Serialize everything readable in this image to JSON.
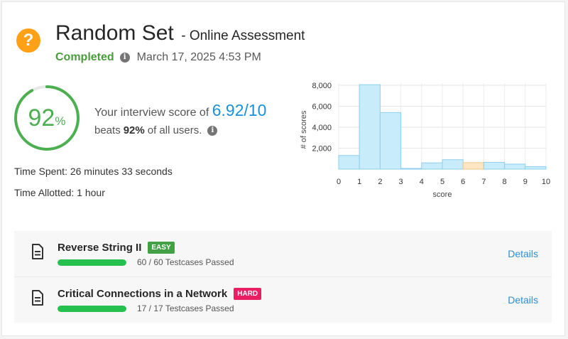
{
  "header": {
    "title": "Random Set",
    "subtitle": "- Online Assessment",
    "status": "Completed",
    "date": "March 17, 2025 4:53 PM",
    "icon": "question-icon"
  },
  "score": {
    "percent": "92",
    "percent_sign": "%",
    "percent_value": 92,
    "line1_prefix": "Your interview score of ",
    "value": "6.92/10",
    "line2_prefix": "beats",
    "line2_bold": "92%",
    "line2_suffix": "of all users."
  },
  "time": {
    "spent": "Time Spent: 26 minutes 33 seconds",
    "allotted": "Time Allotted: 1 hour"
  },
  "chart_data": {
    "type": "bar",
    "title": "",
    "xlabel": "score",
    "ylabel": "# of scores",
    "xlim": [
      0,
      10
    ],
    "ylim": [
      0,
      8200
    ],
    "x_ticks": [
      "0",
      "1",
      "2",
      "3",
      "4",
      "5",
      "6",
      "7",
      "8",
      "9",
      "10"
    ],
    "y_ticks": [
      "2,000",
      "4,000",
      "6,000",
      "8,000"
    ],
    "y_tick_values": [
      2000,
      4000,
      6000,
      8000
    ],
    "bins": [
      {
        "from": 0,
        "to": 1,
        "value": 1300
      },
      {
        "from": 1,
        "to": 2,
        "value": 8050
      },
      {
        "from": 2,
        "to": 3,
        "value": 5400
      },
      {
        "from": 3,
        "to": 4,
        "value": 70
      },
      {
        "from": 4,
        "to": 5,
        "value": 600
      },
      {
        "from": 5,
        "to": 6,
        "value": 900
      },
      {
        "from": 6,
        "to": 7,
        "value": 620,
        "highlight": true
      },
      {
        "from": 7,
        "to": 8,
        "value": 650
      },
      {
        "from": 8,
        "to": 9,
        "value": 480
      },
      {
        "from": 9,
        "to": 10,
        "value": 240
      }
    ],
    "grid": true,
    "colors": {
      "bar_fill": "#c9ecfb",
      "bar_stroke": "#8ccfee",
      "highlight_fill": "#fde6c4",
      "highlight_stroke": "#f3c886"
    }
  },
  "problems": [
    {
      "title": "Reverse String II",
      "difficulty": "EASY",
      "difficulty_color": "#43a047",
      "progress_text": "60 / 60 Testcases Passed",
      "progress": 1.0,
      "details": "Details"
    },
    {
      "title": "Critical Connections in a Network",
      "difficulty": "HARD",
      "difficulty_color": "#e91e63",
      "progress_text": "17 / 17 Testcases Passed",
      "progress": 1.0,
      "details": "Details"
    }
  ]
}
